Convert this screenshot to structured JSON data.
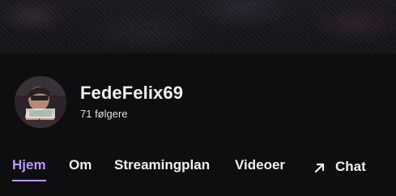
{
  "channel": {
    "name": "FedeFelix69",
    "followers": "71 følgere"
  },
  "tabs": [
    {
      "label": "Hjem",
      "active": true
    },
    {
      "label": "Om",
      "active": false
    },
    {
      "label": "Streamingplan",
      "active": false
    },
    {
      "label": "Videoer",
      "active": false
    },
    {
      "label": "Chat",
      "active": false,
      "icon": "external-arrow-icon"
    }
  ],
  "colors": {
    "background": "#0e0e10",
    "accent": "#bf94ff",
    "text": "#efeff1"
  }
}
